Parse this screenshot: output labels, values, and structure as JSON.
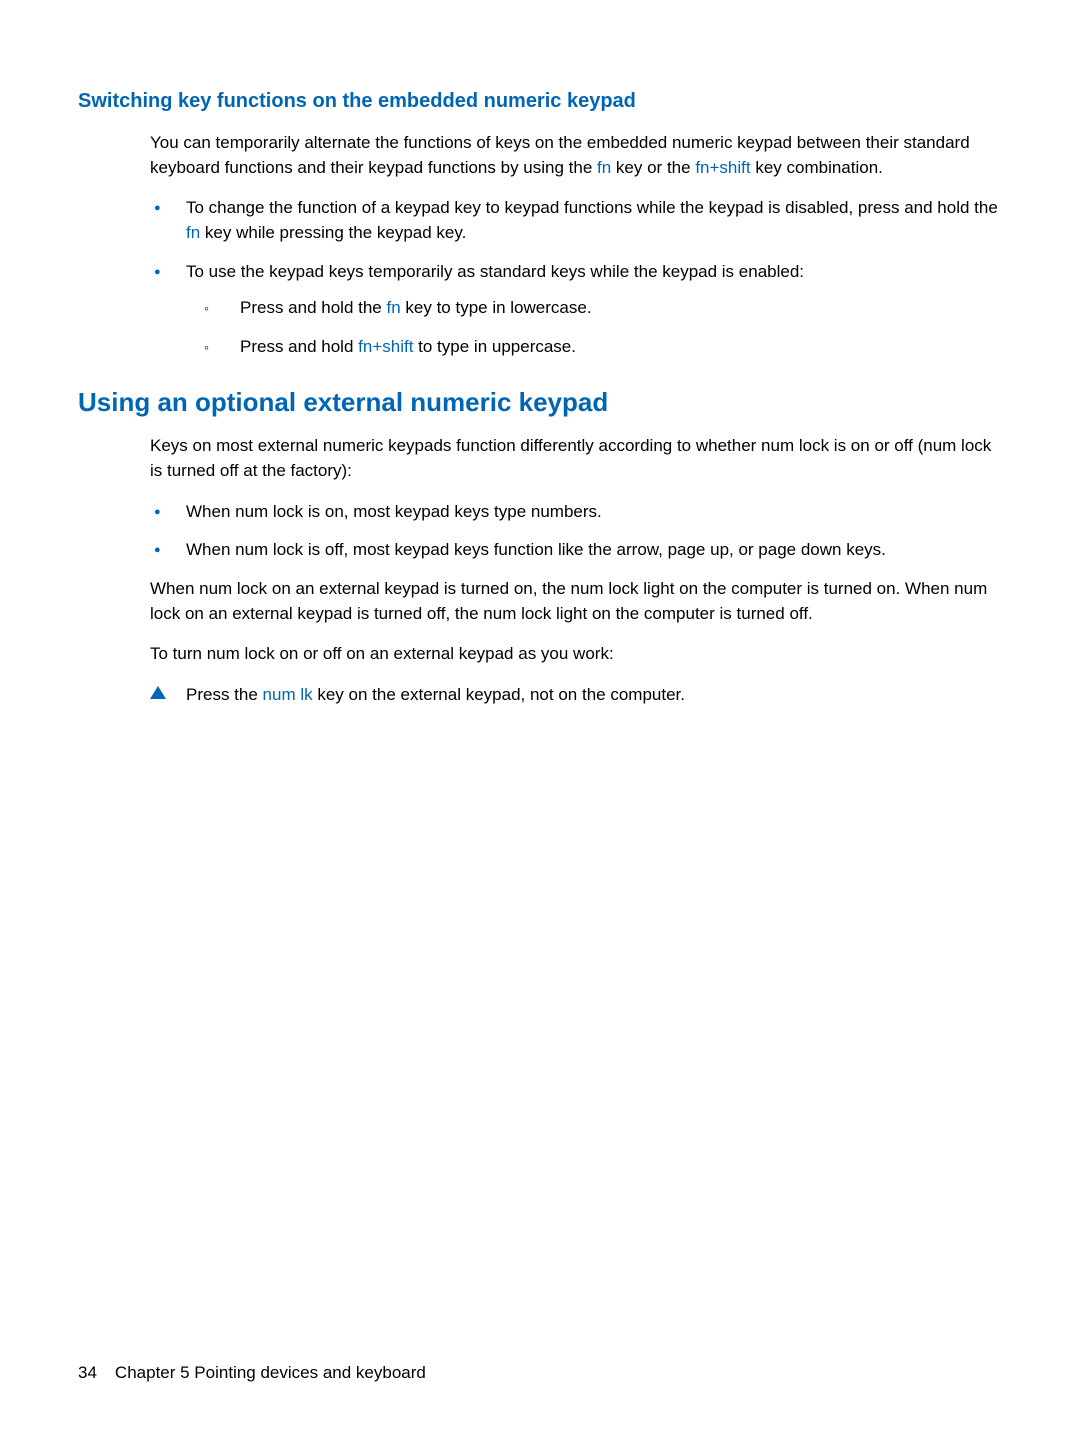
{
  "section1": {
    "heading": "Switching key functions on the embedded numeric keypad",
    "para1_a": "You can temporarily alternate the functions of keys on the embedded numeric keypad between their standard keyboard functions and their keypad functions by using the ",
    "para1_key1": "fn",
    "para1_b": " key or the ",
    "para1_key2": "fn+shift",
    "para1_c": " key combination.",
    "bullet1_a": "To change the function of a keypad key to keypad functions while the keypad is disabled, press and hold the ",
    "bullet1_key": "fn",
    "bullet1_b": " key while pressing the keypad key.",
    "bullet2": "To use the keypad keys temporarily as standard keys while the keypad is enabled:",
    "sub1_a": "Press and hold the ",
    "sub1_key": "fn",
    "sub1_b": " key to type in lowercase.",
    "sub2_a": "Press and hold ",
    "sub2_key": "fn+shift",
    "sub2_b": " to type in uppercase."
  },
  "section2": {
    "heading": "Using an optional external numeric keypad",
    "para1": "Keys on most external numeric keypads function differently according to whether num lock is on or off (num lock is turned off at the factory):",
    "bullet1": "When num lock is on, most keypad keys type numbers.",
    "bullet2": "When num lock is off, most keypad keys function like the arrow, page up, or page down keys.",
    "para2": "When num lock on an external keypad is turned on, the num lock light on the computer is turned on. When num lock on an external keypad is turned off, the num lock light on the computer is turned off.",
    "para3": "To turn num lock on or off on an external keypad as you work:",
    "step_a": "Press the ",
    "step_key": "num lk",
    "step_b": " key on the external keypad, not on the computer."
  },
  "footer": {
    "page_number": "34",
    "chapter": "Chapter 5   Pointing devices and keyboard"
  }
}
